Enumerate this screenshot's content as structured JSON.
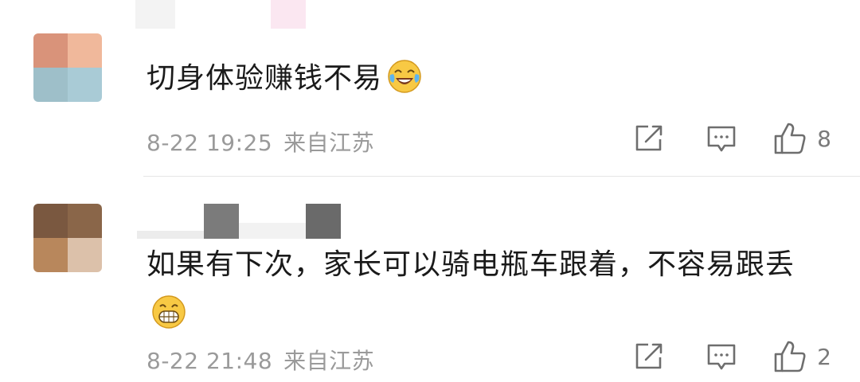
{
  "comments": [
    {
      "text": "切身体验赚钱不易",
      "emoji": "laughing-crying-emoji",
      "date": "8-22 19:25",
      "location": "来自江苏",
      "likes": "8",
      "avatar_colors": [
        "#d9937a",
        "#f0b89b",
        "#9ebfc9",
        "#a9cbd6"
      ]
    },
    {
      "text": "如果有下次，家长可以骑电瓶车跟着，不容易跟丢",
      "emoji": "grinning-emoji",
      "date": "8-22 21:48",
      "location": "来自江苏",
      "likes": "2",
      "avatar_colors": [
        "#7a5840",
        "#8a6649",
        "#b8875c",
        "#dcc1aa"
      ]
    }
  ],
  "icons": {
    "share": "share-icon",
    "comment": "comment-icon",
    "like": "thumbs-up-icon"
  },
  "colors": {
    "meta_text": "#9a9a9a",
    "icon_stroke": "#6e6e6e",
    "divider": "#e6e6e6"
  }
}
